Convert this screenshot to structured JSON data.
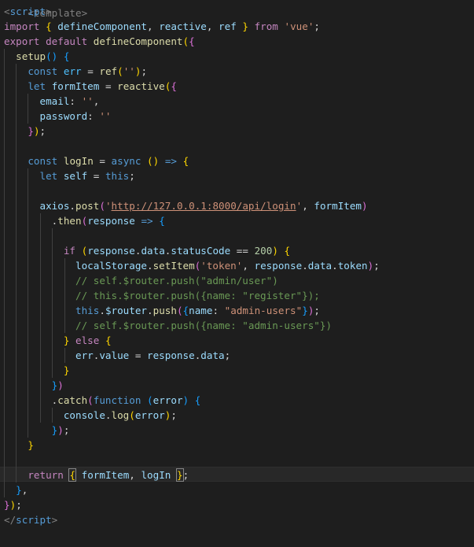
{
  "editor": {
    "language": "vue",
    "cropped_first_line": "<template>",
    "lines": [
      [
        [
          "tag",
          "<"
        ],
        [
          "tagname",
          "script"
        ],
        [
          "tag",
          ">"
        ]
      ],
      [
        [
          "kw",
          "import"
        ],
        [
          "p",
          " "
        ],
        [
          "b1",
          "{"
        ],
        [
          "p",
          " "
        ],
        [
          "var",
          "defineComponent"
        ],
        [
          "p",
          ", "
        ],
        [
          "var",
          "reactive"
        ],
        [
          "p",
          ", "
        ],
        [
          "var",
          "ref"
        ],
        [
          "p",
          " "
        ],
        [
          "b1",
          "}"
        ],
        [
          "p",
          " "
        ],
        [
          "kw",
          "from"
        ],
        [
          "p",
          " "
        ],
        [
          "str",
          "'vue'"
        ],
        [
          "p",
          ";"
        ]
      ],
      [
        [
          "kw",
          "export"
        ],
        [
          "p",
          " "
        ],
        [
          "kw",
          "default"
        ],
        [
          "p",
          " "
        ],
        [
          "fn",
          "defineComponent"
        ],
        [
          "b1",
          "("
        ],
        [
          "b2",
          "{"
        ]
      ],
      [
        [
          "p",
          "  "
        ],
        [
          "fn",
          "setup"
        ],
        [
          "b3",
          "()"
        ],
        [
          "p",
          " "
        ],
        [
          "b3",
          "{"
        ]
      ],
      [
        [
          "p",
          "    "
        ],
        [
          "kw2",
          "const"
        ],
        [
          "p",
          " "
        ],
        [
          "const",
          "err"
        ],
        [
          "p",
          " = "
        ],
        [
          "fn",
          "ref"
        ],
        [
          "b1",
          "("
        ],
        [
          "str",
          "''"
        ],
        [
          "b1",
          ")"
        ],
        [
          "p",
          ";"
        ]
      ],
      [
        [
          "p",
          "    "
        ],
        [
          "kw2",
          "let"
        ],
        [
          "p",
          " "
        ],
        [
          "var",
          "formItem"
        ],
        [
          "p",
          " = "
        ],
        [
          "fn",
          "reactive"
        ],
        [
          "b1",
          "("
        ],
        [
          "b2",
          "{"
        ]
      ],
      [
        [
          "p",
          "      "
        ],
        [
          "var",
          "email"
        ],
        [
          "p",
          ": "
        ],
        [
          "str",
          "''"
        ],
        [
          "p",
          ","
        ]
      ],
      [
        [
          "p",
          "      "
        ],
        [
          "var",
          "password"
        ],
        [
          "p",
          ": "
        ],
        [
          "str",
          "''"
        ]
      ],
      [
        [
          "p",
          "    "
        ],
        [
          "b2",
          "}"
        ],
        [
          "b1",
          ")"
        ],
        [
          "p",
          ";"
        ]
      ],
      [
        [
          "p",
          ""
        ]
      ],
      [
        [
          "p",
          "    "
        ],
        [
          "kw2",
          "const"
        ],
        [
          "p",
          " "
        ],
        [
          "fn",
          "logIn"
        ],
        [
          "p",
          " = "
        ],
        [
          "kw2",
          "async"
        ],
        [
          "p",
          " "
        ],
        [
          "b1",
          "()"
        ],
        [
          "p",
          " "
        ],
        [
          "kw2",
          "=>"
        ],
        [
          "p",
          " "
        ],
        [
          "b1",
          "{"
        ]
      ],
      [
        [
          "p",
          "      "
        ],
        [
          "kw2",
          "let"
        ],
        [
          "p",
          " "
        ],
        [
          "var",
          "self"
        ],
        [
          "p",
          " = "
        ],
        [
          "kw2",
          "this"
        ],
        [
          "p",
          ";"
        ]
      ],
      [
        [
          "p",
          ""
        ]
      ],
      [
        [
          "p",
          "      "
        ],
        [
          "var",
          "axios"
        ],
        [
          "p",
          "."
        ],
        [
          "fn",
          "post"
        ],
        [
          "b2",
          "("
        ],
        [
          "str",
          "'"
        ],
        [
          "url",
          "http://127.0.0.1:8000/api/login"
        ],
        [
          "str",
          "'"
        ],
        [
          "p",
          ", "
        ],
        [
          "var",
          "formItem"
        ],
        [
          "b2",
          ")"
        ]
      ],
      [
        [
          "p",
          "        ."
        ],
        [
          "fn",
          "then"
        ],
        [
          "b2",
          "("
        ],
        [
          "var",
          "response"
        ],
        [
          "p",
          " "
        ],
        [
          "kw2",
          "=>"
        ],
        [
          "p",
          " "
        ],
        [
          "b3",
          "{"
        ]
      ],
      [
        [
          "p",
          ""
        ]
      ],
      [
        [
          "p",
          "          "
        ],
        [
          "kw",
          "if"
        ],
        [
          "p",
          " "
        ],
        [
          "b1",
          "("
        ],
        [
          "var",
          "response"
        ],
        [
          "p",
          "."
        ],
        [
          "var",
          "data"
        ],
        [
          "p",
          "."
        ],
        [
          "var",
          "statusCode"
        ],
        [
          "p",
          " == "
        ],
        [
          "num",
          "200"
        ],
        [
          "b1",
          ")"
        ],
        [
          "p",
          " "
        ],
        [
          "b1",
          "{"
        ]
      ],
      [
        [
          "p",
          "            "
        ],
        [
          "var",
          "localStorage"
        ],
        [
          "p",
          "."
        ],
        [
          "fn",
          "setItem"
        ],
        [
          "b2",
          "("
        ],
        [
          "str",
          "'token'"
        ],
        [
          "p",
          ", "
        ],
        [
          "var",
          "response"
        ],
        [
          "p",
          "."
        ],
        [
          "var",
          "data"
        ],
        [
          "p",
          "."
        ],
        [
          "var",
          "token"
        ],
        [
          "b2",
          ")"
        ],
        [
          "p",
          ";"
        ]
      ],
      [
        [
          "p",
          "            "
        ],
        [
          "cm",
          "// self.$router.push(\"admin/user\")"
        ]
      ],
      [
        [
          "p",
          "            "
        ],
        [
          "cm",
          "// this.$router.push({name: \"register\"});"
        ]
      ],
      [
        [
          "p",
          "            "
        ],
        [
          "kw2",
          "this"
        ],
        [
          "p",
          "."
        ],
        [
          "var",
          "$router"
        ],
        [
          "p",
          "."
        ],
        [
          "fn",
          "push"
        ],
        [
          "b2",
          "("
        ],
        [
          "b3",
          "{"
        ],
        [
          "var",
          "name"
        ],
        [
          "p",
          ": "
        ],
        [
          "str",
          "\"admin-users\""
        ],
        [
          "b3",
          "}"
        ],
        [
          "b2",
          ")"
        ],
        [
          "p",
          ";"
        ]
      ],
      [
        [
          "p",
          "            "
        ],
        [
          "cm",
          "// self.$router.push({name: \"admin-users\"})"
        ]
      ],
      [
        [
          "p",
          "          "
        ],
        [
          "b1",
          "}"
        ],
        [
          "p",
          " "
        ],
        [
          "kw",
          "else"
        ],
        [
          "p",
          " "
        ],
        [
          "b1",
          "{"
        ]
      ],
      [
        [
          "p",
          "            "
        ],
        [
          "var",
          "err"
        ],
        [
          "p",
          "."
        ],
        [
          "var",
          "value"
        ],
        [
          "p",
          " = "
        ],
        [
          "var",
          "response"
        ],
        [
          "p",
          "."
        ],
        [
          "var",
          "data"
        ],
        [
          "p",
          ";"
        ]
      ],
      [
        [
          "p",
          "          "
        ],
        [
          "b1",
          "}"
        ]
      ],
      [
        [
          "p",
          "        "
        ],
        [
          "b3",
          "}"
        ],
        [
          "b2",
          ")"
        ]
      ],
      [
        [
          "p",
          "        ."
        ],
        [
          "fn",
          "catch"
        ],
        [
          "b2",
          "("
        ],
        [
          "kw2",
          "function"
        ],
        [
          "p",
          " "
        ],
        [
          "b3",
          "("
        ],
        [
          "var",
          "error"
        ],
        [
          "b3",
          ")"
        ],
        [
          "p",
          " "
        ],
        [
          "b3",
          "{"
        ]
      ],
      [
        [
          "p",
          "          "
        ],
        [
          "var",
          "console"
        ],
        [
          "p",
          "."
        ],
        [
          "fn",
          "log"
        ],
        [
          "b1",
          "("
        ],
        [
          "var",
          "error"
        ],
        [
          "b1",
          ")"
        ],
        [
          "p",
          ";"
        ]
      ],
      [
        [
          "p",
          "        "
        ],
        [
          "b3",
          "}"
        ],
        [
          "b2",
          ")"
        ],
        [
          "p",
          ";"
        ]
      ],
      [
        [
          "p",
          "    "
        ],
        [
          "b1",
          "}"
        ]
      ],
      [
        [
          "p",
          ""
        ]
      ],
      [
        [
          "p",
          "    "
        ],
        [
          "kw",
          "return"
        ],
        [
          "p",
          " "
        ],
        [
          "box",
          "{"
        ],
        [
          "p",
          " "
        ],
        [
          "var",
          "formItem"
        ],
        [
          "p",
          ", "
        ],
        [
          "var",
          "logIn"
        ],
        [
          "p",
          " "
        ],
        [
          "box",
          "}"
        ],
        [
          "p",
          ";"
        ]
      ],
      [
        [
          "p",
          "  "
        ],
        [
          "b3",
          "}"
        ],
        [
          "p",
          ","
        ]
      ],
      [
        [
          "b2",
          "}"
        ],
        [
          "b1",
          ")"
        ],
        [
          "p",
          ";"
        ]
      ],
      [
        [
          "tag",
          "</"
        ],
        [
          "tagname",
          "script"
        ],
        [
          "tag",
          ">"
        ]
      ]
    ]
  }
}
